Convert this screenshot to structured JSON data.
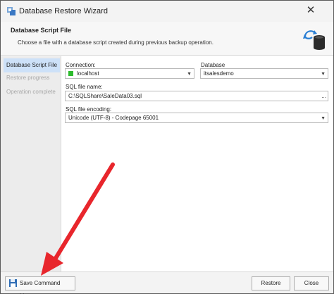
{
  "window": {
    "title": "Database Restore Wizard",
    "close_glyph": "✕"
  },
  "header": {
    "title": "Database Script File",
    "description": "Choose a file with a database script created during previous backup operation.",
    "icon": "database-restore-icon"
  },
  "nav": {
    "items": [
      {
        "label": "Database Script File",
        "active": true
      },
      {
        "label": "Restore progress",
        "active": false
      },
      {
        "label": "Operation complete",
        "active": false
      }
    ]
  },
  "form": {
    "connection": {
      "label": "Connection:",
      "value": "localhost",
      "status_color": "#2dbb2d"
    },
    "database": {
      "label": "Database",
      "value": "itsalesdemo"
    },
    "sql_file": {
      "label": "SQL file name:",
      "value": "C:\\SQLShare\\SaleData03.sql",
      "browse": "..."
    },
    "encoding": {
      "label": "SQL file encoding:",
      "value": "Unicode (UTF-8) - Codepage 65001"
    }
  },
  "footer": {
    "save_label": "Save Command Line...",
    "restore_label": "Restore",
    "close_label": "Close"
  },
  "annotation": {
    "arrow_color": "#e8262c"
  }
}
